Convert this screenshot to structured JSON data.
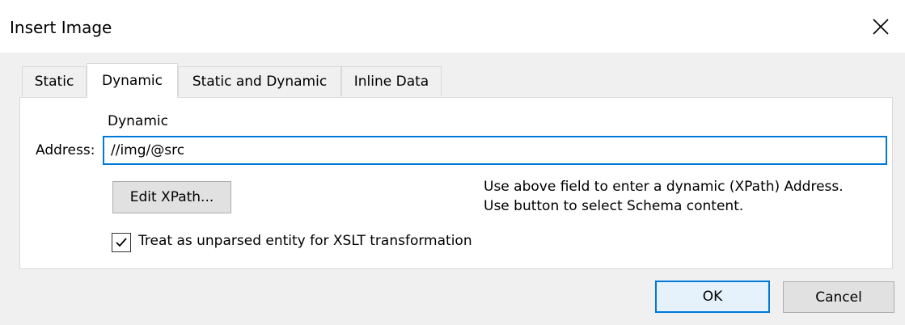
{
  "window": {
    "title": "Insert Image",
    "close_icon": "close-icon"
  },
  "tabs": [
    {
      "label": "Static",
      "active": false
    },
    {
      "label": "Dynamic",
      "active": true
    },
    {
      "label": "Static and Dynamic",
      "active": false
    },
    {
      "label": "Inline Data",
      "active": false
    }
  ],
  "dynamic_panel": {
    "section_label": "Dynamic",
    "address_label_pre": "Address",
    "address_label_underline": "",
    "address_label_full": "Address:",
    "address_value": "//img/@src",
    "edit_xpath_label": "Edit XPath...",
    "hint_line1": "Use above field to enter a dynamic (XPath) Address.",
    "hint_line2": "Use button to select Schema content.",
    "checkbox_label": "Treat as unparsed entity for XSLT transformation",
    "checkbox_checked": true
  },
  "footer": {
    "ok_label": "OK",
    "cancel_label": "Cancel"
  },
  "colors": {
    "accent": "#0078d7",
    "dialog_bg": "#f0f0f0",
    "panel_bg": "#ffffff"
  }
}
